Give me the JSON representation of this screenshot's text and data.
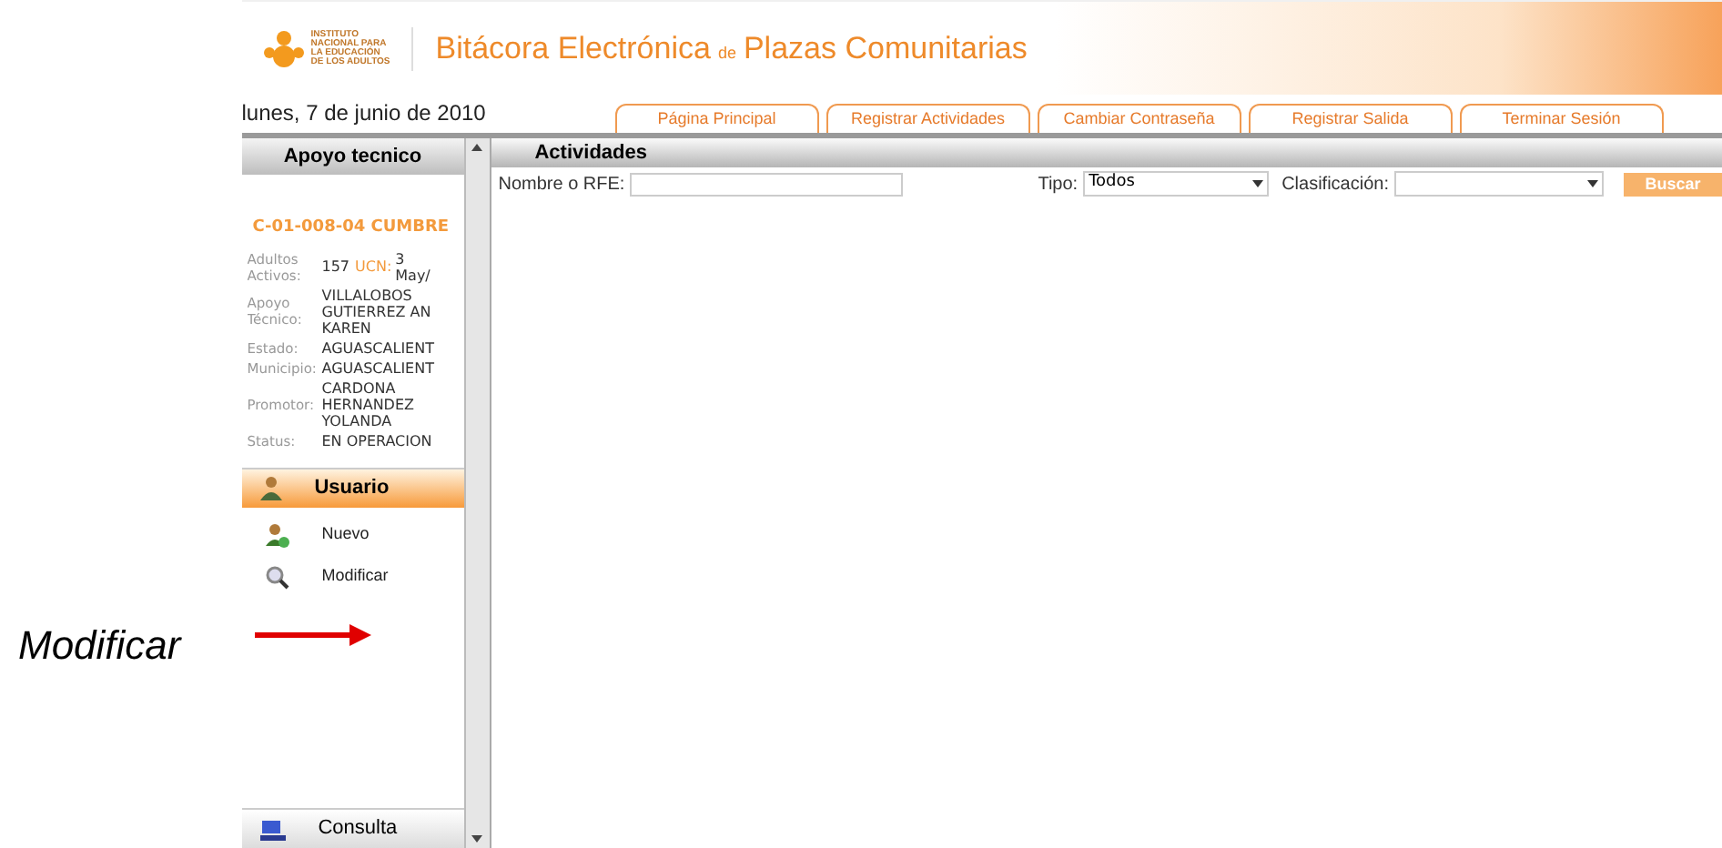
{
  "annotation": {
    "text": "Modificar"
  },
  "header": {
    "logo_lines": [
      "INSTITUTO",
      "NACIONAL PARA",
      "LA EDUCACIÓN",
      "DE LOS ADULTOS"
    ],
    "title_parts": [
      {
        "kind": "main",
        "text": "Bitácora Electrónica"
      },
      {
        "kind": "small",
        "text": "de"
      },
      {
        "kind": "main",
        "text": "Plazas Comunitarias"
      }
    ]
  },
  "date": "lunes, 7 de junio de 2010",
  "tabs": [
    "Página Principal",
    "Registrar Actividades",
    "Cambiar Contraseña",
    "Registrar Salida",
    "Terminar Sesión"
  ],
  "sidebar": {
    "title": "Apoyo tecnico",
    "center": "C-01-008-04 CUMBRE",
    "info": [
      {
        "label": [
          "Adultos",
          "Activos:"
        ],
        "value": [
          "157"
        ],
        "extra_label": "UCN:",
        "extra_value": [
          "3",
          "May/"
        ]
      },
      {
        "label": [
          "Apoyo",
          "Técnico:"
        ],
        "value": [
          "VILLALOBOS",
          "GUTIERREZ AN",
          "KAREN"
        ]
      },
      {
        "label": [
          "Estado:"
        ],
        "value": [
          "AGUASCALIENT"
        ]
      },
      {
        "label": [
          "Municipio:"
        ],
        "value": [
          "AGUASCALIENT"
        ]
      },
      {
        "label": [
          "Promotor:"
        ],
        "value": [
          "CARDONA",
          "HERNANDEZ",
          "YOLANDA"
        ]
      },
      {
        "label": [
          "Status:"
        ],
        "value": [
          "EN OPERACION"
        ]
      }
    ],
    "sections": [
      {
        "label": "Usuario",
        "expanded": true,
        "items": [
          {
            "kind": "new-user",
            "label": "Nuevo"
          },
          {
            "kind": "search",
            "label": "Modificar"
          }
        ]
      },
      {
        "label": "Consulta",
        "expanded": false
      }
    ]
  },
  "main": {
    "title": "Actividades",
    "name_label": "Nombre o RFE:",
    "type_label": "Tipo:",
    "type_value": "Todos",
    "class_label": "Clasificación:",
    "button": "Buscar"
  }
}
